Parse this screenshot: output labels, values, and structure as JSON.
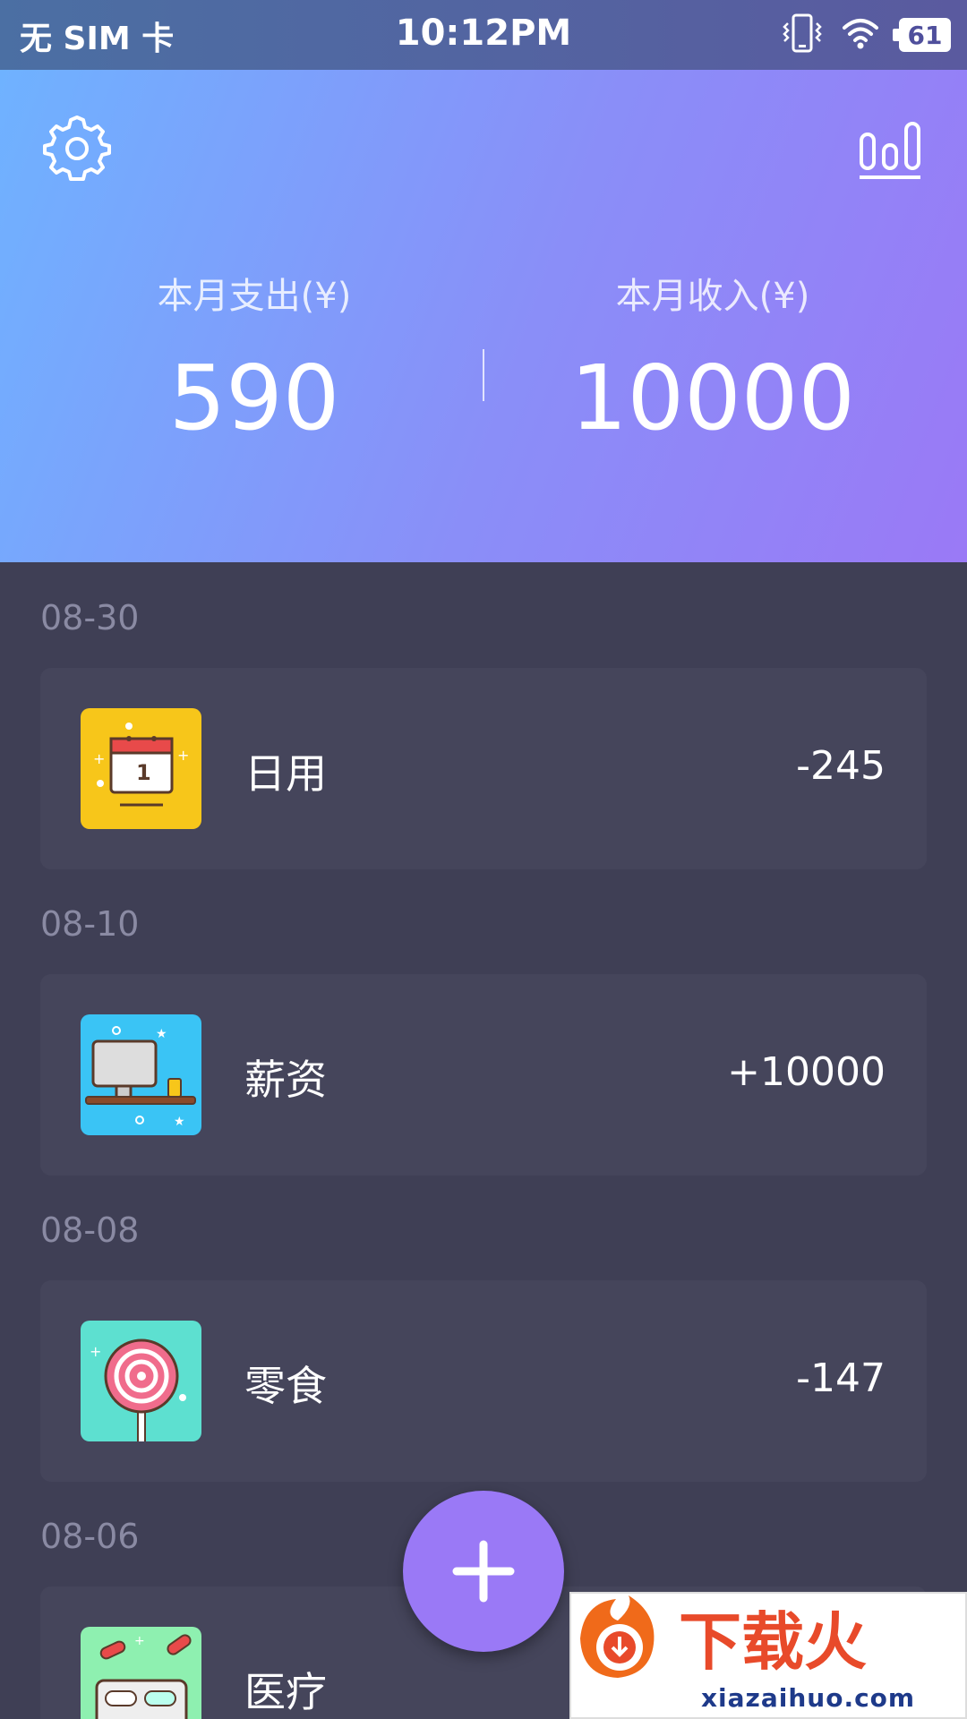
{
  "status_bar": {
    "carrier": "无 SIM 卡",
    "time": "10:12PM",
    "battery": "61"
  },
  "header": {
    "expense_label": "本月支出(¥)",
    "expense_value": "590",
    "income_label": "本月收入(¥)",
    "income_value": "10000",
    "gradient_start": "#6fb2ff",
    "gradient_end": "#9a79f6"
  },
  "transactions": [
    {
      "date": "08-30",
      "category": "日用",
      "amount": "-245",
      "icon": "calendar-icon",
      "icon_bg": "#f7c61a"
    },
    {
      "date": "08-10",
      "category": "薪资",
      "amount": "+10000",
      "icon": "computer-desk-icon",
      "icon_bg": "#3ac4f5"
    },
    {
      "date": "08-08",
      "category": "零食",
      "amount": "-147",
      "icon": "lollipop-icon",
      "icon_bg": "#5de0d0"
    },
    {
      "date": "08-06",
      "category": "医疗",
      "amount": "",
      "icon": "pills-icon",
      "icon_bg": "#8ef0b0"
    }
  ],
  "fab": {
    "icon": "plus-icon",
    "color": "#9a79f6"
  },
  "watermark": {
    "brand": "下载火",
    "url": "xiazaihuo.com"
  }
}
